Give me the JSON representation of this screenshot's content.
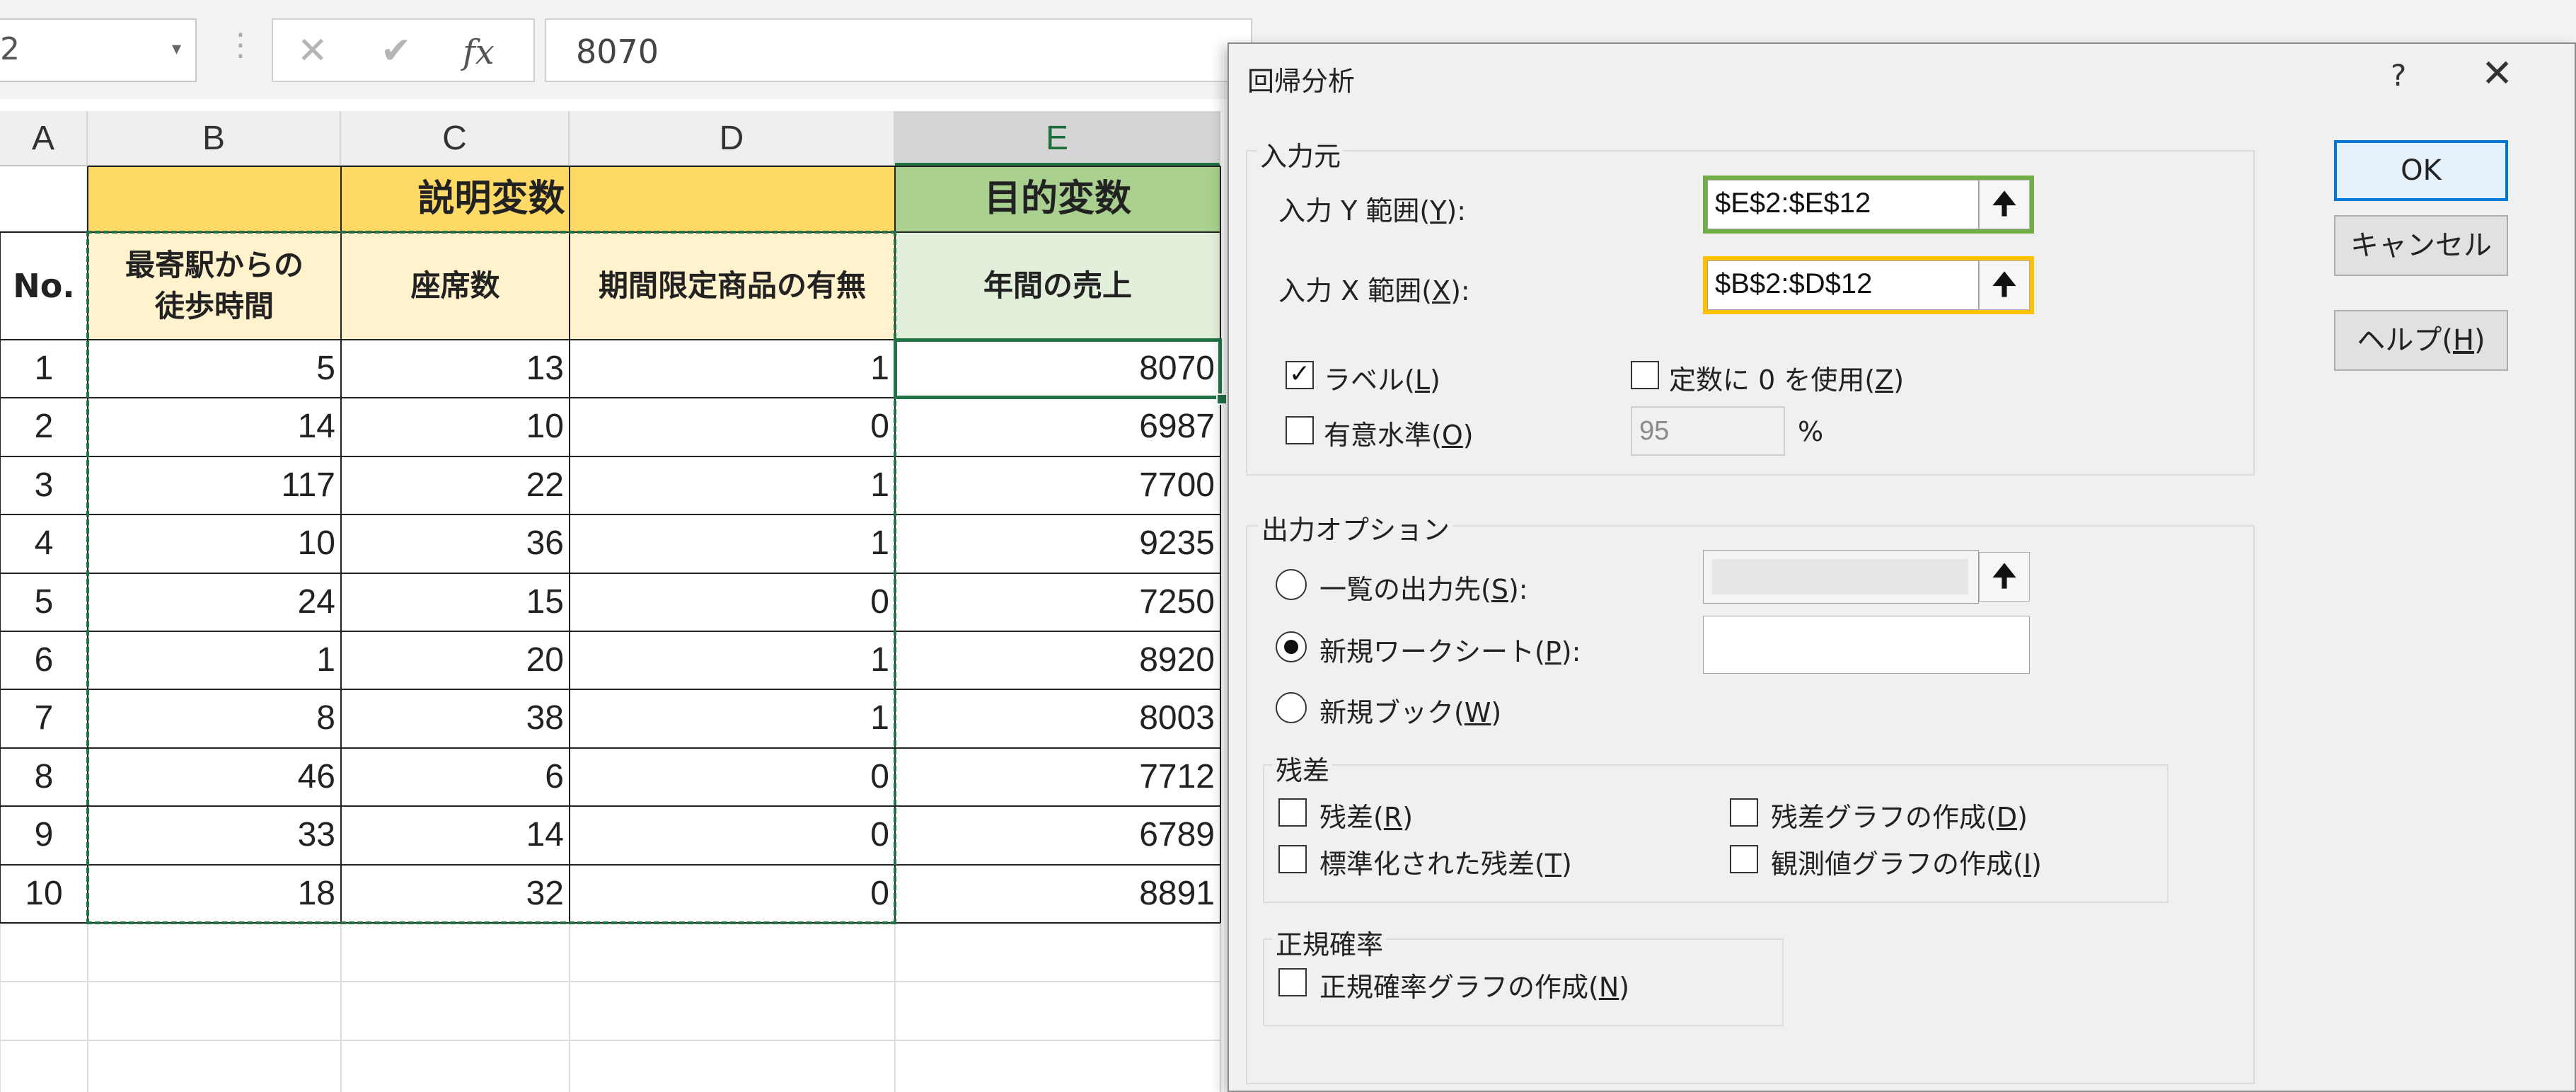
{
  "formula_bar": {
    "name_box": "2",
    "name_dropdown_icon": "▾",
    "separator_icon": "⋮",
    "cancel_icon": "✕",
    "enter_icon": "✔",
    "fx_label": "fx",
    "formula": "8070"
  },
  "sheet": {
    "columns": [
      "A",
      "B",
      "C",
      "D",
      "E"
    ],
    "selected_column": "E",
    "group_headers": {
      "explanatory": "説明変数",
      "target": "目的変数"
    },
    "headers": {
      "no": "No.",
      "walk_line1": "最寄駅からの",
      "walk_line2": "徒歩時間",
      "seats": "座席数",
      "limited": "期間限定商品の有無",
      "sales": "年間の売上"
    },
    "colors": {
      "explanatory_header": "#ffd966",
      "explanatory_sub": "#fff2cc",
      "target_header": "#a9d08e",
      "target_sub": "#e2efda",
      "selection": "#217346"
    },
    "rows": [
      [
        "1",
        "5",
        "13",
        "1",
        "8070"
      ],
      [
        "2",
        "14",
        "10",
        "0",
        "6987"
      ],
      [
        "3",
        "117",
        "22",
        "1",
        "7700"
      ],
      [
        "4",
        "10",
        "36",
        "1",
        "9235"
      ],
      [
        "5",
        "24",
        "15",
        "0",
        "7250"
      ],
      [
        "6",
        "1",
        "20",
        "1",
        "8920"
      ],
      [
        "7",
        "8",
        "38",
        "1",
        "8003"
      ],
      [
        "8",
        "46",
        "6",
        "0",
        "7712"
      ],
      [
        "9",
        "33",
        "14",
        "0",
        "6789"
      ],
      [
        "10",
        "18",
        "32",
        "0",
        "8891"
      ]
    ]
  },
  "dialog": {
    "title": "回帰分析",
    "help_icon": "?",
    "close_icon": "✕",
    "input": {
      "group_label": "入力元",
      "y_label": "入力 Y 範囲(",
      "y_key": "Y",
      "y_suffix": "):",
      "y_value": "$E$2:$E$12",
      "x_label": "入力 X 範囲(",
      "x_key": "X",
      "x_suffix": "):",
      "x_value": "$B$2:$D$12",
      "ref_icon": "🠉",
      "label_cb": {
        "text": "ラベル(",
        "key": "L",
        "end": ")",
        "checked": true,
        "mark": "✓"
      },
      "const_cb": {
        "text": "定数に 0 を使用(",
        "key": "Z",
        "end": ")",
        "checked": false
      },
      "conf_cb": {
        "text": "有意水準(",
        "key": "O",
        "end": ")",
        "checked": false
      },
      "conf_value": "95",
      "percent": "%",
      "highlight_y": "#70ad47",
      "highlight_x": "#ffc000"
    },
    "output": {
      "group_label": "出力オプション",
      "range": {
        "text": "一覧の出力先(",
        "key": "S",
        "end": "):",
        "selected": false
      },
      "new_sheet": {
        "text": "新規ワークシート(",
        "key": "P",
        "end": "):",
        "selected": true
      },
      "new_book": {
        "text": "新規ブック(",
        "key": "W",
        "end": ")",
        "selected": false
      },
      "residuals_label": "残差",
      "residuals": {
        "text": "残差(",
        "key": "R",
        "end": ")"
      },
      "residual_plot": {
        "text": "残差グラフの作成(",
        "key": "D",
        "end": ")"
      },
      "std_residuals": {
        "text": "標準化された残差(",
        "key": "T",
        "end": ")"
      },
      "line_fit": {
        "text": "観測値グラフの作成(",
        "key": "I",
        "end": ")"
      },
      "normal_label": "正規確率",
      "normal_plot": {
        "text": "正規確率グラフの作成(",
        "key": "N",
        "end": ")"
      }
    },
    "buttons": {
      "ok": "OK",
      "cancel": "キャンセル",
      "help_text": "ヘルプ(",
      "help_key": "H",
      "help_end": ")"
    }
  }
}
